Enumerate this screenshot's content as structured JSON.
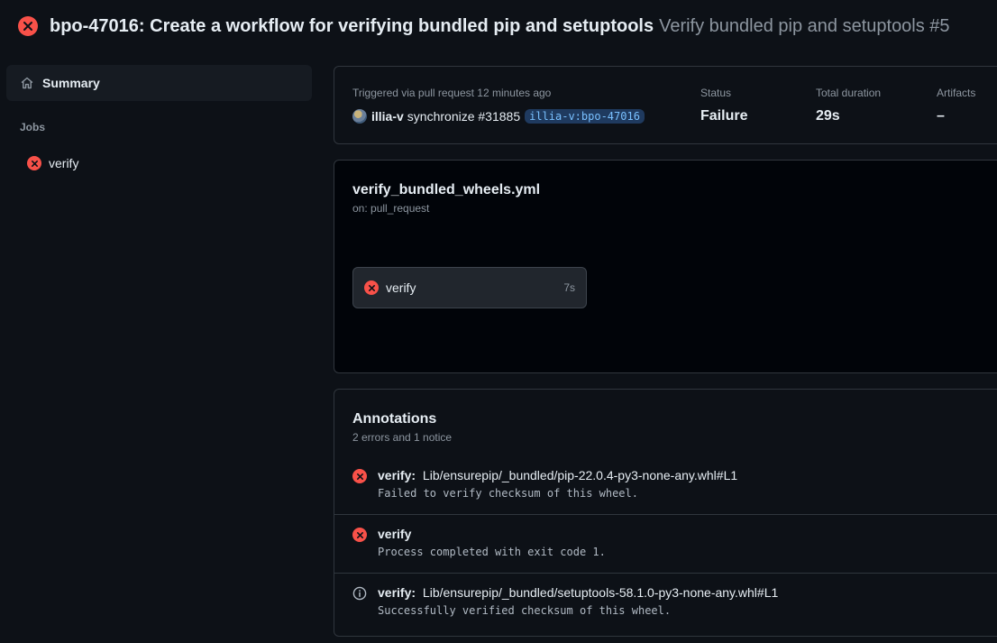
{
  "header": {
    "title": "bpo-47016: Create a workflow for verifying bundled pip and setuptools",
    "subtitle": "Verify bundled pip and setuptools #5",
    "status_icon": "x-circle-fill-icon"
  },
  "sidebar": {
    "summary_label": "Summary",
    "jobs_heading": "Jobs",
    "jobs": [
      {
        "label": "verify",
        "status": "failure"
      }
    ]
  },
  "run_summary": {
    "trigger_text": "Triggered via pull request 12 minutes ago",
    "user": "illia-v",
    "action": "synchronize #31885",
    "branch": "illia-v:bpo-47016",
    "status_label": "Status",
    "status_value": "Failure",
    "duration_label": "Total duration",
    "duration_value": "29s",
    "artifacts_label": "Artifacts",
    "artifacts_value": "–"
  },
  "workflow": {
    "file": "verify_bundled_wheels.yml",
    "trigger": "on: pull_request",
    "job": {
      "name": "verify",
      "duration": "7s"
    }
  },
  "annotations": {
    "title": "Annotations",
    "summary": "2 errors and 1 notice",
    "items": [
      {
        "type": "error",
        "job": "verify:",
        "path": "Lib/ensurepip/_bundled/pip-22.0.4-py3-none-any.whl#L1",
        "message": "Failed to verify checksum of this wheel."
      },
      {
        "type": "error",
        "job": "verify",
        "path": "",
        "message": "Process completed with exit code 1."
      },
      {
        "type": "notice",
        "job": "verify:",
        "path": "Lib/ensurepip/_bundled/setuptools-58.1.0-py3-none-any.whl#L1",
        "message": "Successfully verified checksum of this wheel."
      }
    ]
  },
  "colors": {
    "background": "#0d1117",
    "failure": "#f85149",
    "branch_text": "#79c0ff",
    "muted_text": "#8d96a0"
  }
}
